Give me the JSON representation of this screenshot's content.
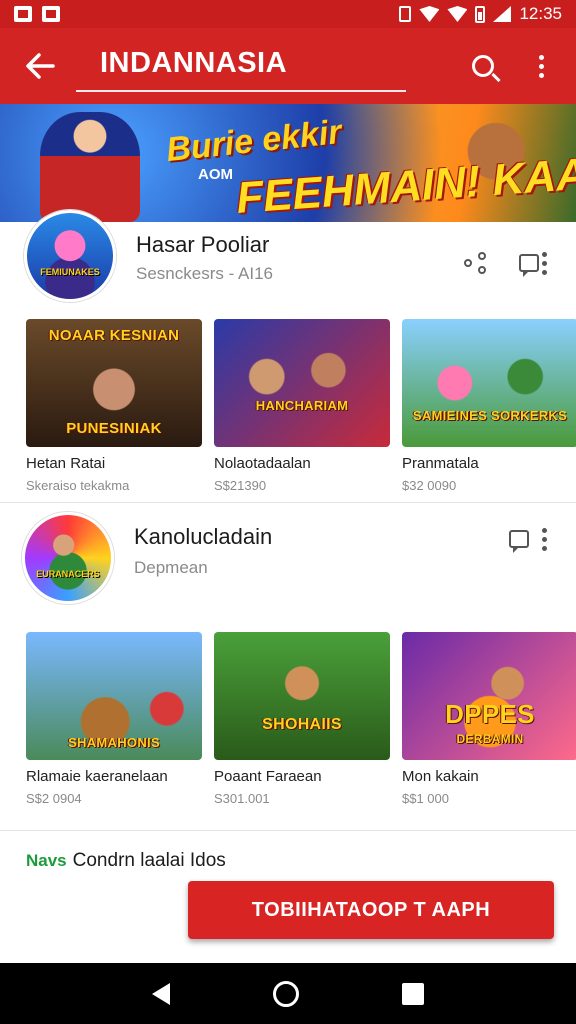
{
  "status_bar": {
    "time": "12:35"
  },
  "app_bar": {
    "title": "INDANNASIA"
  },
  "banner": {
    "line1": "Burie ekkir",
    "line2": "AOM",
    "line3": "FEEHMAIN! KAAN!"
  },
  "channels": [
    {
      "name": "Hasar Pooliar",
      "subtitle": "Sesnckesrs - AI16",
      "avatar_text": "FEMIUNAKES",
      "videos": [
        {
          "thumb_text": "PUNESINIAK",
          "thumb_text_top": "NOAAR KESNIAN",
          "title": "Hetan Ratai",
          "meta": "Skeraiso tekakma"
        },
        {
          "thumb_text": "HANCHARIAM",
          "title": "Nolaotadaalan",
          "meta": "S$21390"
        },
        {
          "thumb_text": "SAMIEINES SORKERKS",
          "title": "Pranmatala",
          "meta": "$32 0090"
        }
      ]
    },
    {
      "name": "Kanolucladain",
      "subtitle": "Depmean",
      "avatar_text": "EURANACERS",
      "videos": [
        {
          "thumb_text": "SHAMAHONIS",
          "title": "Rlamaie kaeranelaan",
          "meta": "S$2 0904"
        },
        {
          "thumb_text": "SHOHAIIS",
          "title": "Poaant Faraean",
          "meta": "S301.001"
        },
        {
          "thumb_text": "DPPES",
          "thumb_text_sub": "DERBAMIN",
          "title": "Mon kakain",
          "meta": "$$1 000"
        }
      ]
    }
  ],
  "footer": {
    "tag": "Navs",
    "text": "Condrn laalai Idos"
  },
  "cta": {
    "label": "TOBIIHATAOOP T AAPH"
  },
  "icons": {
    "back": "arrow-left-icon",
    "search": "search-icon",
    "more": "more-vert-icon",
    "share": "share-icon",
    "comment": "comment-icon"
  },
  "colors": {
    "primary": "#d32424",
    "accent_text": "#ffd21e",
    "tag_green": "#1e9a3a"
  }
}
